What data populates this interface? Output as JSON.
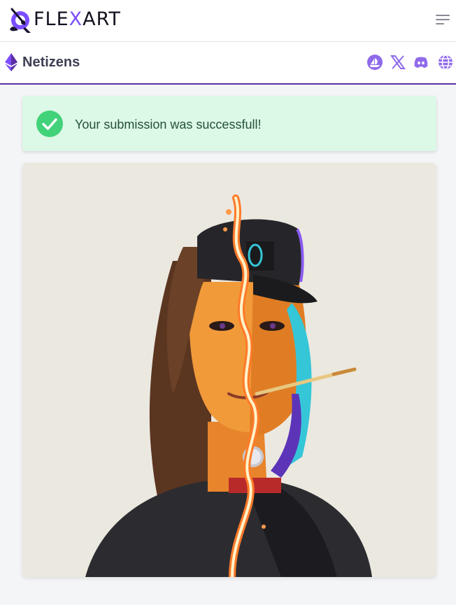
{
  "header": {
    "logo_text_before": "FLE",
    "logo_text_x": "X",
    "logo_text_after": "ART",
    "menu_icon": "hamburger-icon"
  },
  "collection": {
    "chain_icon": "ethereum-icon",
    "name": "Netizens",
    "social_icons": [
      "opensea-icon",
      "x-icon",
      "discord-icon",
      "globe-icon"
    ]
  },
  "alert": {
    "status": "success",
    "icon": "check-circle-icon",
    "message": "Your submission was successfull!"
  },
  "nft_image": {
    "icon": "nft-artwork"
  },
  "colors": {
    "brand_purple": "#7c4dff",
    "success_green": "#42d27a",
    "alert_background": "#dcf8e6",
    "collection_border": "#5b2fa3"
  }
}
